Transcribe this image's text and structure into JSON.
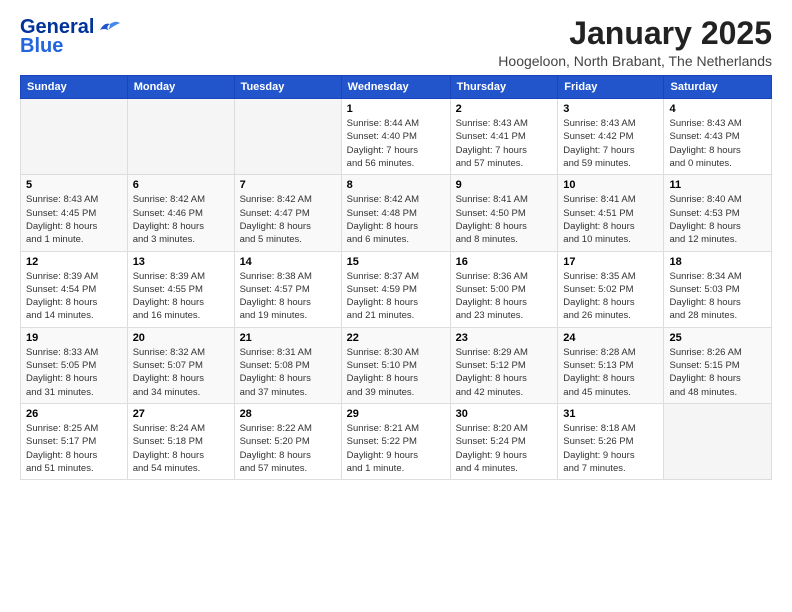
{
  "header": {
    "logo_line1": "General",
    "logo_line2": "Blue",
    "month_title": "January 2025",
    "location": "Hoogeloon, North Brabant, The Netherlands"
  },
  "columns": [
    "Sunday",
    "Monday",
    "Tuesday",
    "Wednesday",
    "Thursday",
    "Friday",
    "Saturday"
  ],
  "weeks": [
    [
      {
        "day": "",
        "info": ""
      },
      {
        "day": "",
        "info": ""
      },
      {
        "day": "",
        "info": ""
      },
      {
        "day": "1",
        "info": "Sunrise: 8:44 AM\nSunset: 4:40 PM\nDaylight: 7 hours\nand 56 minutes."
      },
      {
        "day": "2",
        "info": "Sunrise: 8:43 AM\nSunset: 4:41 PM\nDaylight: 7 hours\nand 57 minutes."
      },
      {
        "day": "3",
        "info": "Sunrise: 8:43 AM\nSunset: 4:42 PM\nDaylight: 7 hours\nand 59 minutes."
      },
      {
        "day": "4",
        "info": "Sunrise: 8:43 AM\nSunset: 4:43 PM\nDaylight: 8 hours\nand 0 minutes."
      }
    ],
    [
      {
        "day": "5",
        "info": "Sunrise: 8:43 AM\nSunset: 4:45 PM\nDaylight: 8 hours\nand 1 minute."
      },
      {
        "day": "6",
        "info": "Sunrise: 8:42 AM\nSunset: 4:46 PM\nDaylight: 8 hours\nand 3 minutes."
      },
      {
        "day": "7",
        "info": "Sunrise: 8:42 AM\nSunset: 4:47 PM\nDaylight: 8 hours\nand 5 minutes."
      },
      {
        "day": "8",
        "info": "Sunrise: 8:42 AM\nSunset: 4:48 PM\nDaylight: 8 hours\nand 6 minutes."
      },
      {
        "day": "9",
        "info": "Sunrise: 8:41 AM\nSunset: 4:50 PM\nDaylight: 8 hours\nand 8 minutes."
      },
      {
        "day": "10",
        "info": "Sunrise: 8:41 AM\nSunset: 4:51 PM\nDaylight: 8 hours\nand 10 minutes."
      },
      {
        "day": "11",
        "info": "Sunrise: 8:40 AM\nSunset: 4:53 PM\nDaylight: 8 hours\nand 12 minutes."
      }
    ],
    [
      {
        "day": "12",
        "info": "Sunrise: 8:39 AM\nSunset: 4:54 PM\nDaylight: 8 hours\nand 14 minutes."
      },
      {
        "day": "13",
        "info": "Sunrise: 8:39 AM\nSunset: 4:55 PM\nDaylight: 8 hours\nand 16 minutes."
      },
      {
        "day": "14",
        "info": "Sunrise: 8:38 AM\nSunset: 4:57 PM\nDaylight: 8 hours\nand 19 minutes."
      },
      {
        "day": "15",
        "info": "Sunrise: 8:37 AM\nSunset: 4:59 PM\nDaylight: 8 hours\nand 21 minutes."
      },
      {
        "day": "16",
        "info": "Sunrise: 8:36 AM\nSunset: 5:00 PM\nDaylight: 8 hours\nand 23 minutes."
      },
      {
        "day": "17",
        "info": "Sunrise: 8:35 AM\nSunset: 5:02 PM\nDaylight: 8 hours\nand 26 minutes."
      },
      {
        "day": "18",
        "info": "Sunrise: 8:34 AM\nSunset: 5:03 PM\nDaylight: 8 hours\nand 28 minutes."
      }
    ],
    [
      {
        "day": "19",
        "info": "Sunrise: 8:33 AM\nSunset: 5:05 PM\nDaylight: 8 hours\nand 31 minutes."
      },
      {
        "day": "20",
        "info": "Sunrise: 8:32 AM\nSunset: 5:07 PM\nDaylight: 8 hours\nand 34 minutes."
      },
      {
        "day": "21",
        "info": "Sunrise: 8:31 AM\nSunset: 5:08 PM\nDaylight: 8 hours\nand 37 minutes."
      },
      {
        "day": "22",
        "info": "Sunrise: 8:30 AM\nSunset: 5:10 PM\nDaylight: 8 hours\nand 39 minutes."
      },
      {
        "day": "23",
        "info": "Sunrise: 8:29 AM\nSunset: 5:12 PM\nDaylight: 8 hours\nand 42 minutes."
      },
      {
        "day": "24",
        "info": "Sunrise: 8:28 AM\nSunset: 5:13 PM\nDaylight: 8 hours\nand 45 minutes."
      },
      {
        "day": "25",
        "info": "Sunrise: 8:26 AM\nSunset: 5:15 PM\nDaylight: 8 hours\nand 48 minutes."
      }
    ],
    [
      {
        "day": "26",
        "info": "Sunrise: 8:25 AM\nSunset: 5:17 PM\nDaylight: 8 hours\nand 51 minutes."
      },
      {
        "day": "27",
        "info": "Sunrise: 8:24 AM\nSunset: 5:18 PM\nDaylight: 8 hours\nand 54 minutes."
      },
      {
        "day": "28",
        "info": "Sunrise: 8:22 AM\nSunset: 5:20 PM\nDaylight: 8 hours\nand 57 minutes."
      },
      {
        "day": "29",
        "info": "Sunrise: 8:21 AM\nSunset: 5:22 PM\nDaylight: 9 hours\nand 1 minute."
      },
      {
        "day": "30",
        "info": "Sunrise: 8:20 AM\nSunset: 5:24 PM\nDaylight: 9 hours\nand 4 minutes."
      },
      {
        "day": "31",
        "info": "Sunrise: 8:18 AM\nSunset: 5:26 PM\nDaylight: 9 hours\nand 7 minutes."
      },
      {
        "day": "",
        "info": ""
      }
    ]
  ]
}
